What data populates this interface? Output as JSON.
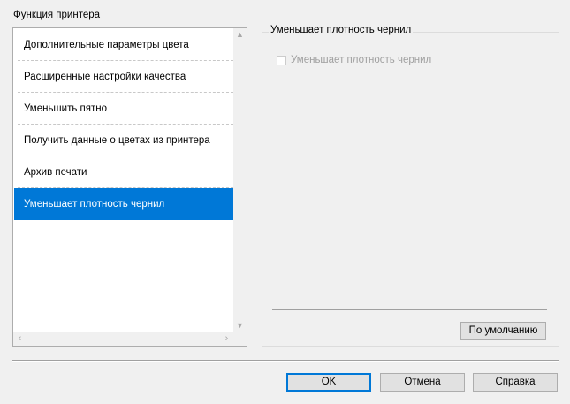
{
  "group_label": "Функция принтера",
  "feature_list": {
    "items": [
      {
        "label": "Дополнительные параметры цвета",
        "selected": false
      },
      {
        "label": "Расширенные настройки качества",
        "selected": false
      },
      {
        "label": "Уменьшить пятно",
        "selected": false
      },
      {
        "label": "Получить данные о цветах из принтера",
        "selected": false
      },
      {
        "label": "Архив печати",
        "selected": false
      },
      {
        "label": "Уменьшает плотность чернил",
        "selected": true
      }
    ],
    "scroll_up_icon": "▲",
    "scroll_down_icon": "▼",
    "scroll_left_icon": "‹",
    "scroll_right_icon": "›"
  },
  "options_group": {
    "title": "Уменьшает плотность чернил",
    "checkbox_label": "Уменьшает плотность чернил",
    "checkbox_checked": false,
    "checkbox_enabled": false,
    "default_button": "По умолчанию"
  },
  "buttons": {
    "ok": "OK",
    "cancel": "Отмена",
    "help": "Справка"
  },
  "colors": {
    "selection": "#0078d7",
    "dialog_background": "#f0f0f0",
    "disabled_text": "#a0a0a0"
  }
}
